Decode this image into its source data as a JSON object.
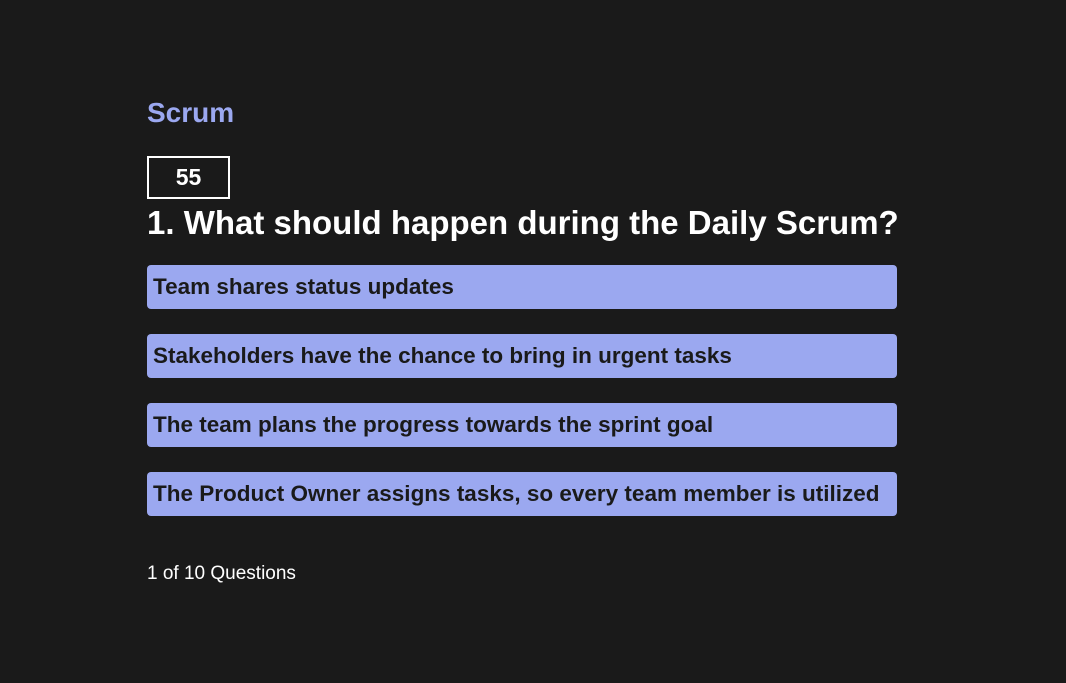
{
  "app": {
    "title": "Scrum"
  },
  "timer": {
    "value": "55"
  },
  "question": {
    "text": "1. What should happen during the Daily Scrum?"
  },
  "answers": [
    {
      "label": "Team shares status updates"
    },
    {
      "label": "Stakeholders have the chance to bring in urgent tasks"
    },
    {
      "label": "The team plans the progress towards the sprint goal"
    },
    {
      "label": "The Product Owner assigns tasks, so every team member is utilized"
    }
  ],
  "progress": {
    "text": "1 of 10 Questions"
  },
  "colors": {
    "background": "#1a1a1a",
    "accent": "#9ba8f0",
    "answer_text": "#1a1a1a",
    "text": "#ffffff"
  }
}
